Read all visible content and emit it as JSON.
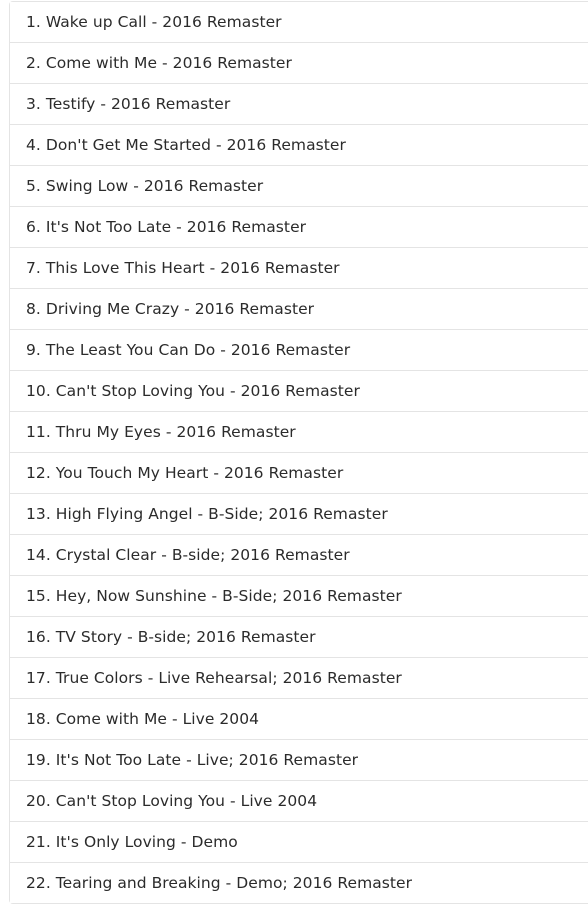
{
  "tracks": [
    "1. Wake up Call - 2016 Remaster",
    "2. Come with Me - 2016 Remaster",
    "3. Testify - 2016 Remaster",
    "4. Don't Get Me Started - 2016 Remaster",
    "5. Swing Low - 2016 Remaster",
    "6. It's Not Too Late - 2016 Remaster",
    "7. This Love This Heart - 2016 Remaster",
    "8. Driving Me Crazy - 2016 Remaster",
    "9. The Least You Can Do - 2016 Remaster",
    "10. Can't Stop Loving You - 2016 Remaster",
    "11. Thru My Eyes - 2016 Remaster",
    "12. You Touch My Heart - 2016 Remaster",
    "13. High Flying Angel - B-Side; 2016 Remaster",
    "14. Crystal Clear - B-side; 2016 Remaster",
    "15. Hey, Now Sunshine - B-Side; 2016 Remaster",
    "16. TV Story - B-side; 2016 Remaster",
    "17. True Colors - Live Rehearsal; 2016 Remaster",
    "18. Come with Me - Live 2004",
    "19. It's Not Too Late - Live; 2016 Remaster",
    "20. Can't Stop Loving You - Live 2004",
    "21. It's Only Loving - Demo",
    "22. Tearing and Breaking - Demo; 2016 Remaster"
  ]
}
